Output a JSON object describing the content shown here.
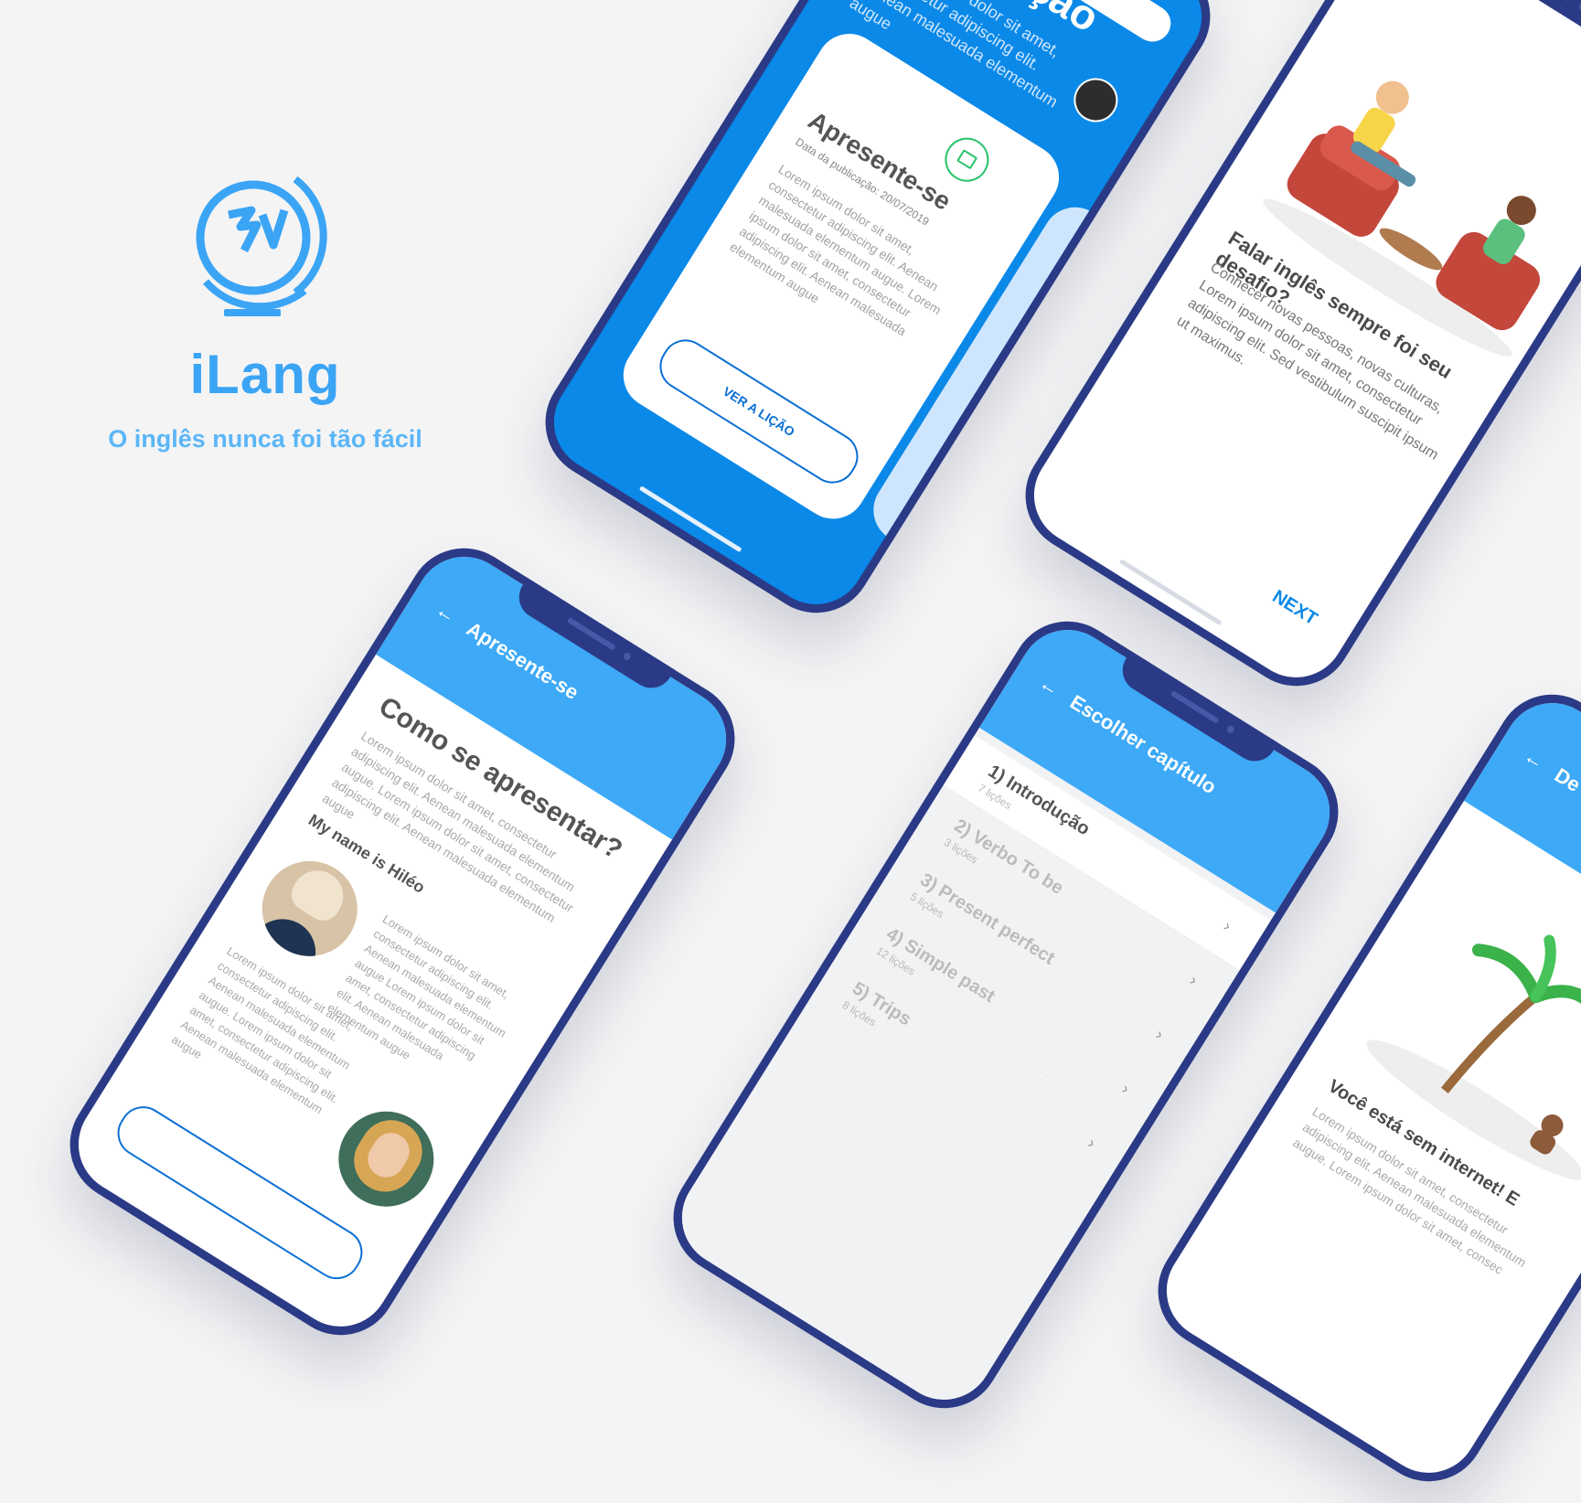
{
  "brand": {
    "name": "iLang",
    "tagline": "O inglês nunca foi tão fácil",
    "color": "#3ba4f5"
  },
  "intro_screen": {
    "title": "Introdução",
    "description": "Lorem ipsum dolor sit amet, consectetur adipiscing elit. Aenean malesuada elementum augue",
    "card": {
      "icon": "lock-icon",
      "title": "Apresente-se",
      "date": "Data da publicação: 20/07/2019",
      "text": "Lorem ipsum dolor sit amet, consectetur adipiscing elit. Aenean malesuada elementum augue. Lorem ipsum dolor sit amet, consectetur adipiscing elit. Aenean malesuada elementum augue",
      "button": "VER A LIÇÃO"
    }
  },
  "onboarding_screen": {
    "title": "Falar inglês sempre foi seu desafio?",
    "text": "Conhecer novas pessoas, novas culturas, Lorem ipsum dolor sit amet, consectetur adipiscing elit. Sed vestibulum suscipit ipsum ut maximus.",
    "next": "NEXT"
  },
  "present_screen": {
    "header": "Apresente-se",
    "heading": "Como se apresentar?",
    "intro_text": "Lorem ipsum dolor sit amet, consectetur adipiscing elit. Aenean malesuada elementum augue. Lorem ipsum dolor sit amet, consectetur adipiscing elit. Aenean malesuada elementum augue",
    "subheading": "My name is Hiléo",
    "text_right": "Lorem ipsum dolor sit amet, consectetur adipiscing elit. Aenean malesuada elementum augue Lorem ipsum dolor sit amet, consectetur adipiscing elit. Aenean malesuada elementum augue",
    "text_left": "Lorem ipsum dolor sit amet, consectetur adipiscing elit. Aenean malesuada elementum augue. Lorem ipsum dolor sit amet, consectetur adipiscing elit. Aenean malesuada elementum augue"
  },
  "chapters_screen": {
    "header": "Escolher capítulo",
    "chapters": [
      {
        "title": "1) Introdução",
        "count": "7 lições"
      },
      {
        "title": "2) Verbo To be",
        "count": "3 lições"
      },
      {
        "title": "3) Present perfect",
        "count": "5 lições"
      },
      {
        "title": "4) Simple past",
        "count": "12 lições"
      },
      {
        "title": "5) Trips",
        "count": "8 lições"
      }
    ]
  },
  "offline_screen": {
    "header": "De",
    "title": "Você está sem internet! E",
    "text": "Lorem ipsum dolor sit amet, consectetur adipiscing elit. Aenean malesuada elementum augue. Lorem ipsum dolor sit amet, consec"
  },
  "colors": {
    "primary_blue": "#0b89e8",
    "light_blue": "#3da9f7",
    "frame": "#2b3a86",
    "lock_green": "#28c46a"
  }
}
